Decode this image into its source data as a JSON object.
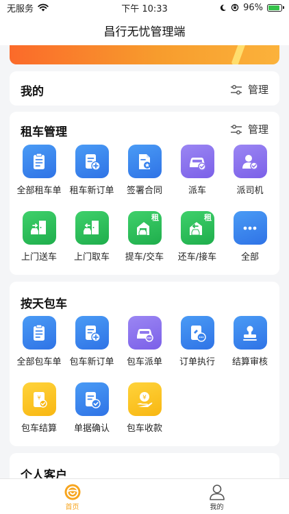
{
  "status_bar": {
    "carrier": "无服务",
    "time": "下午 10:33",
    "battery": "96%"
  },
  "nav": {
    "title": "昌行无忧管理端"
  },
  "mine_section": {
    "title": "我的",
    "manage_label": "管理"
  },
  "rental_section": {
    "title": "租车管理",
    "manage_label": "管理",
    "items": [
      {
        "label": "全部租车单",
        "icon": "clipboard-icon"
      },
      {
        "label": "租车新订单",
        "icon": "new-order-icon"
      },
      {
        "label": "签署合同",
        "icon": "contract-star-icon"
      },
      {
        "label": "派车",
        "icon": "dispatch-car-icon"
      },
      {
        "label": "派司机",
        "icon": "assign-driver-icon"
      },
      {
        "label": "上门送车",
        "icon": "door-delivery-icon"
      },
      {
        "label": "上门取车",
        "icon": "door-pickup-icon"
      },
      {
        "label": "提车/交车",
        "icon": "pickup-handover-icon",
        "badge": "租"
      },
      {
        "label": "还车/接车",
        "icon": "return-receive-icon",
        "badge": "租"
      },
      {
        "label": "全部",
        "icon": "more-icon"
      }
    ]
  },
  "charter_section": {
    "title": "按天包车",
    "items": [
      {
        "label": "全部包车单",
        "icon": "clipboard-icon"
      },
      {
        "label": "包车新订单",
        "icon": "new-order-icon"
      },
      {
        "label": "包车派单",
        "icon": "car-dispatch-icon"
      },
      {
        "label": "订单执行",
        "icon": "order-execute-icon"
      },
      {
        "label": "结算审核",
        "icon": "stamp-icon"
      },
      {
        "label": "包车结算",
        "icon": "yuan-settlement-icon"
      },
      {
        "label": "单据确认",
        "icon": "doc-confirm-icon"
      },
      {
        "label": "包车收款",
        "icon": "yuan-hand-icon"
      }
    ]
  },
  "personal_section": {
    "title": "个人客户"
  },
  "tabbar": {
    "home_label": "首页",
    "mine_label": "我的"
  },
  "colors": {
    "accent": "#f7a51e",
    "blue": "#2f73e6",
    "purple": "#7b60e8",
    "green": "#1fae4c",
    "yellow": "#f8b712"
  }
}
